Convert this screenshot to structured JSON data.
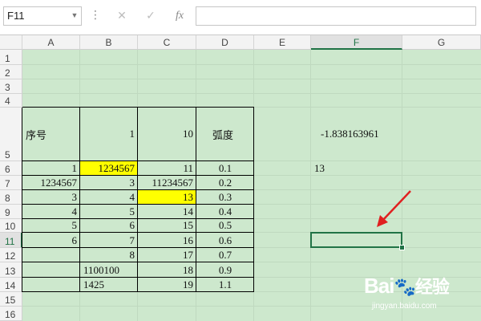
{
  "formula_bar": {
    "name_box": "F11",
    "cancel_icon": "✕",
    "enter_icon": "✓",
    "fx_icon": "fx",
    "formula_value": ""
  },
  "columns": [
    "A",
    "B",
    "C",
    "D",
    "E",
    "F",
    "G"
  ],
  "rows": [
    "1",
    "2",
    "3",
    "4",
    "5",
    "6",
    "7",
    "8",
    "9",
    "10",
    "11",
    "12",
    "13",
    "14",
    "15",
    "16"
  ],
  "selected_cell": "F11",
  "cells": {
    "A5": "序号",
    "B5": "1",
    "C5": "10",
    "D5": "弧度",
    "F5": "-1.838163961",
    "A6": "1",
    "B6": "1234567",
    "C6": "11",
    "D6": "0.1",
    "F6": "13",
    "A7": "1234567",
    "B7": "3",
    "C7": "11234567",
    "D7": "0.2",
    "A8": "3",
    "B8": "4",
    "C8": "13",
    "D8": "0.3",
    "A9": "4",
    "B9": "5",
    "C9": "14",
    "D9": "0.4",
    "A10": "5",
    "B10": "6",
    "C10": "15",
    "D10": "0.5",
    "A11": "6",
    "B11": "7",
    "C11": "16",
    "D11": "0.6",
    "B12": "8",
    "C12": "17",
    "D12": "0.7",
    "B13": "1100100",
    "C13": "18",
    "D13": "0.9",
    "B14": "1425",
    "C14": "19",
    "D14": "1.1"
  },
  "highlighted_cells": [
    "B6",
    "C8"
  ],
  "colors": {
    "sheet_bg": "#cde8cd",
    "highlight": "#ffff00",
    "selection": "#217346",
    "arrow": "#e02020"
  },
  "watermark": {
    "brand": "Bai",
    "brand2": "经验",
    "url": "jingyan.baidu.com"
  }
}
